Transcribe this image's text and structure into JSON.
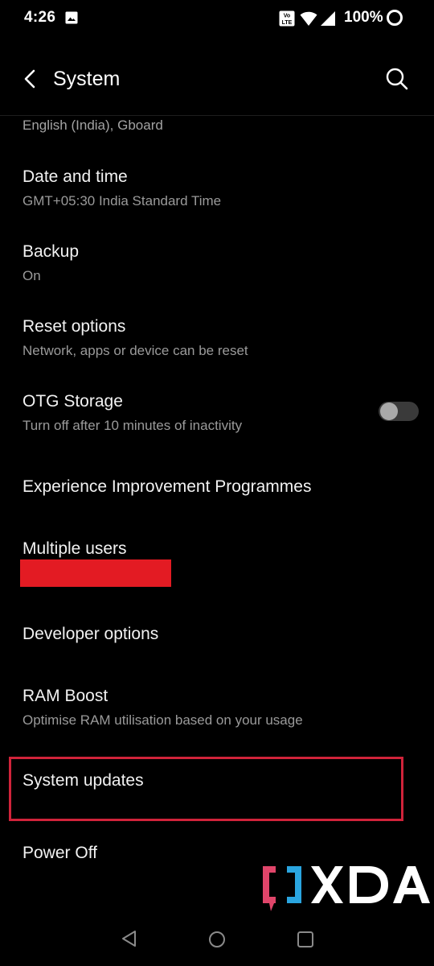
{
  "status_bar": {
    "time": "4:26",
    "battery": "100%",
    "icons": [
      "gallery-icon",
      "volte-icon",
      "wifi-icon",
      "signal-icon",
      "battery-ring-icon"
    ]
  },
  "header": {
    "title": "System",
    "back_icon": "chevron-left-icon",
    "search_icon": "search-icon"
  },
  "items": [
    {
      "title": "",
      "subtitle": "English (India), Gboard"
    },
    {
      "title": "Date and time",
      "subtitle": "GMT+05:30 India Standard Time"
    },
    {
      "title": "Backup",
      "subtitle": "On"
    },
    {
      "title": "Reset options",
      "subtitle": "Network, apps or device can be reset"
    },
    {
      "title": "OTG Storage",
      "subtitle": "Turn off after 10 minutes of inactivity",
      "toggle": false
    },
    {
      "title": "Experience Improvement Programmes",
      "subtitle": ""
    },
    {
      "title": "Multiple users",
      "subtitle": ""
    },
    {
      "title": "Developer options",
      "subtitle": ""
    },
    {
      "title": "RAM Boost",
      "subtitle": "Optimise RAM utilisation based on your usage"
    },
    {
      "title": "System updates",
      "subtitle": ""
    },
    {
      "title": "Power Off",
      "subtitle": ""
    }
  ],
  "annotations": {
    "redaction_color": "#e31b23",
    "highlight_color": "#d0233a"
  },
  "watermark": {
    "text": "XDA",
    "colors": {
      "pink": "#e0456a",
      "blue": "#2aa5e0",
      "white": "#ffffff"
    }
  },
  "nav_bar": {
    "icons": [
      "nav-back-icon",
      "nav-home-icon",
      "nav-recents-icon"
    ]
  }
}
